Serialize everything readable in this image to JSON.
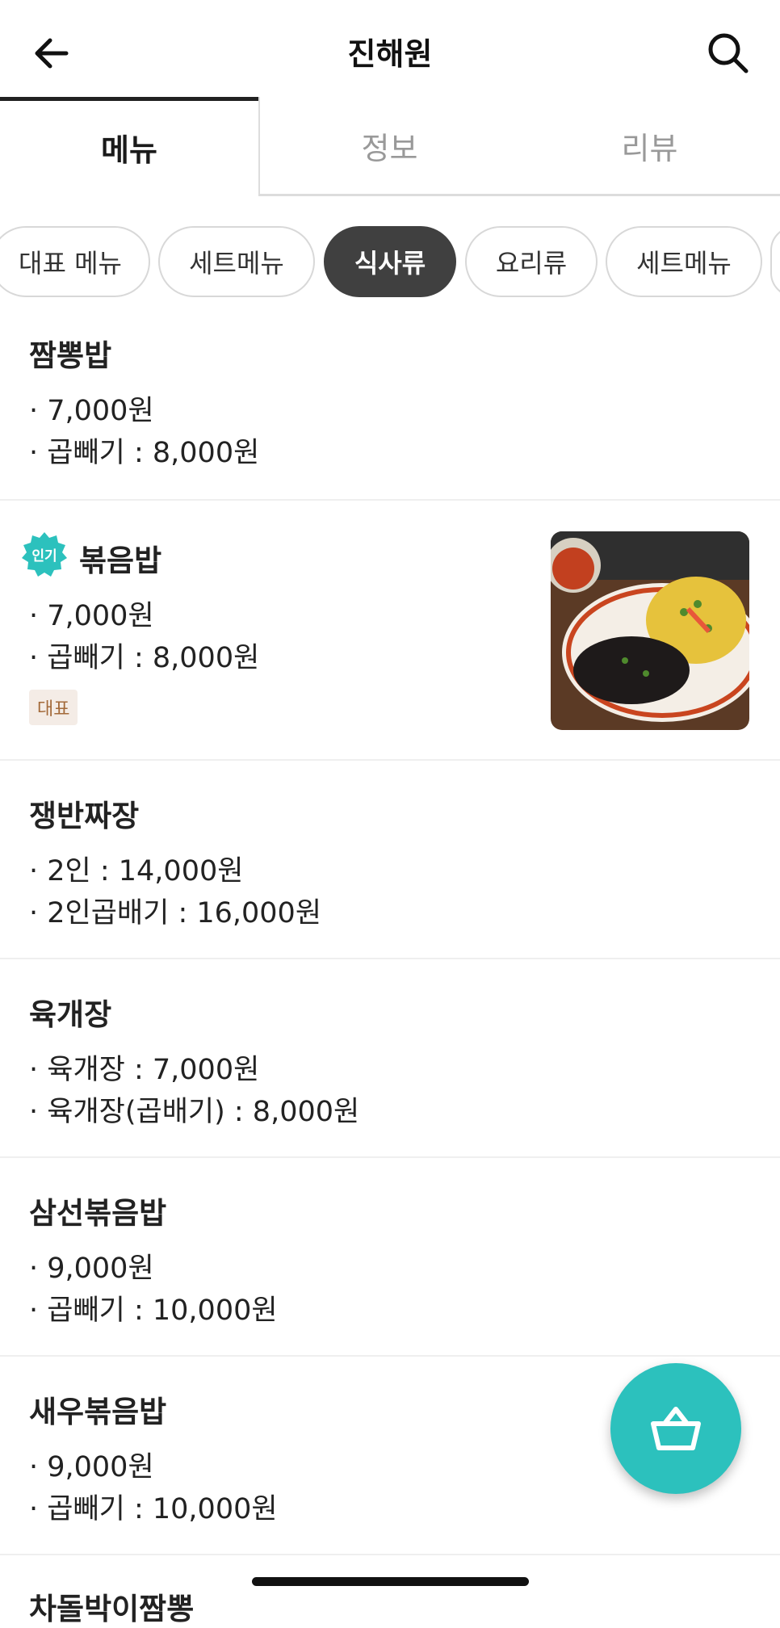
{
  "header": {
    "title": "진해원",
    "back_icon": "arrow-left-icon",
    "search_icon": "search-icon"
  },
  "tabs": [
    {
      "label": "메뉴",
      "active": true
    },
    {
      "label": "정보",
      "active": false
    },
    {
      "label": "리뷰",
      "active": false
    }
  ],
  "chips": [
    {
      "label": "대표 메뉴",
      "active": false
    },
    {
      "label": "세트메뉴",
      "active": false
    },
    {
      "label": "식사류",
      "active": true
    },
    {
      "label": "요리류",
      "active": false
    },
    {
      "label": "세트메뉴",
      "active": false
    }
  ],
  "menu": [
    {
      "name": "짬뽕밥",
      "prices": [
        "· 7,000원",
        "· 곱빼기 : 8,000원"
      ]
    },
    {
      "name": "볶음밥",
      "popular_badge": "인기",
      "prices": [
        "· 7,000원",
        "· 곱빼기 : 8,000원"
      ],
      "tag": "대표",
      "has_photo": true
    },
    {
      "name": "쟁반짜장",
      "prices": [
        "· 2인 : 14,000원",
        "· 2인곱배기 : 16,000원"
      ]
    },
    {
      "name": "육개장",
      "prices": [
        "· 육개장 : 7,000원",
        "· 육개장(곱배기) : 8,000원"
      ]
    },
    {
      "name": "삼선볶음밥",
      "prices": [
        "· 9,000원",
        "· 곱빼기 : 10,000원"
      ]
    },
    {
      "name": "새우볶음밥",
      "prices": [
        "· 9,000원",
        "· 곱빼기 : 10,000원"
      ]
    },
    {
      "name": "차돌박이짬뽕",
      "prices": []
    }
  ],
  "cart": {
    "icon": "basket-icon"
  },
  "colors": {
    "accent": "#2cc1bd",
    "chip_active": "#404040",
    "tag_bg": "#f4ece6",
    "tag_text": "#a36a3a"
  }
}
